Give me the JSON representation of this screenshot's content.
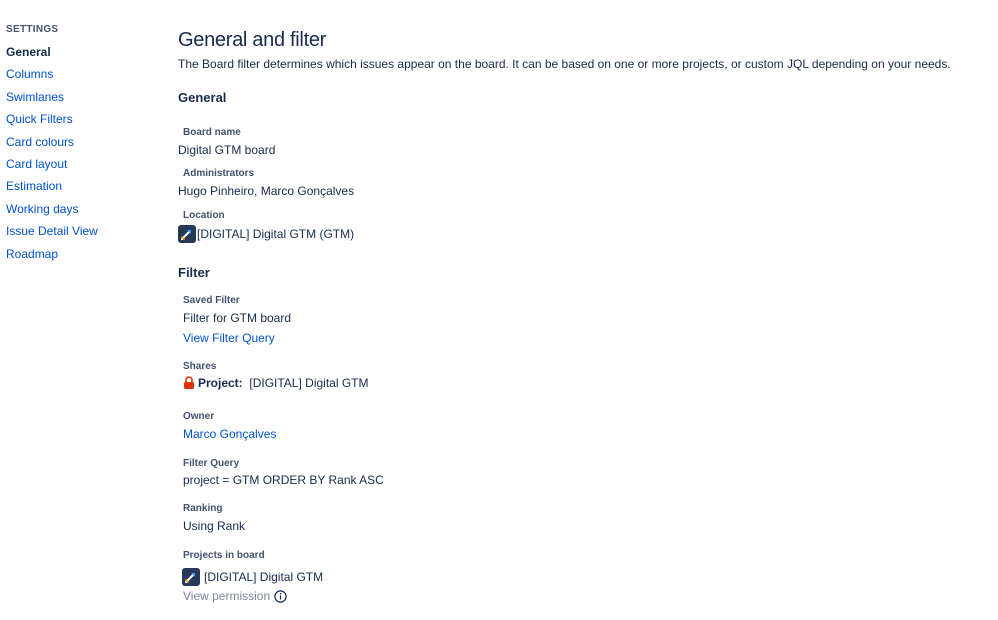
{
  "sidebar": {
    "heading": "SETTINGS",
    "items": [
      {
        "label": "General",
        "active": true
      },
      {
        "label": "Columns"
      },
      {
        "label": "Swimlanes"
      },
      {
        "label": "Quick Filters"
      },
      {
        "label": "Card colours"
      },
      {
        "label": "Card layout"
      },
      {
        "label": "Estimation"
      },
      {
        "label": "Working days"
      },
      {
        "label": "Issue Detail View"
      },
      {
        "label": "Roadmap"
      }
    ]
  },
  "page": {
    "title": "General and filter",
    "description": "The Board filter determines which issues appear on the board. It can be based on one or more projects, or custom JQL depending on your needs."
  },
  "general": {
    "heading": "General",
    "board_name_label": "Board name",
    "board_name": "Digital GTM board",
    "administrators_label": "Administrators",
    "administrators": "Hugo Pinheiro, Marco Gonçalves",
    "location_label": "Location",
    "location": "[DIGITAL] Digital GTM (GTM)"
  },
  "filter": {
    "heading": "Filter",
    "saved_filter_label": "Saved Filter",
    "saved_filter": "Filter for GTM board",
    "view_filter_query": "View Filter Query",
    "shares_label": "Shares",
    "shares_type": "Project:",
    "shares_value": "[DIGITAL] Digital GTM",
    "owner_label": "Owner",
    "owner": "Marco Gonçalves",
    "filter_query_label": "Filter Query",
    "filter_query": "project = GTM ORDER BY Rank ASC",
    "ranking_label": "Ranking",
    "ranking": "Using Rank",
    "projects_label": "Projects in board",
    "project": "[DIGITAL] Digital GTM",
    "view_permission": "View permission"
  },
  "icons": {
    "project_avatar": "rocket-icon",
    "shares": "lock-icon",
    "view_permission": "info-icon"
  },
  "colors": {
    "link": "#0052cc",
    "text": "#172b4d",
    "label": "#42526e",
    "lock": "#de350b",
    "avatar_bg": "#253858"
  }
}
